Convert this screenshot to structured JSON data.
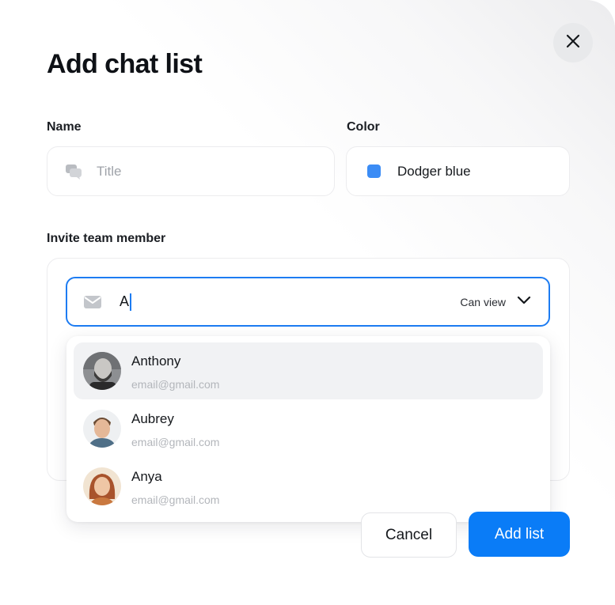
{
  "dialog": {
    "title": "Add chat list",
    "close_icon": "close-icon"
  },
  "name_field": {
    "label": "Name",
    "placeholder": "Title",
    "icon": "chat-bubbles-icon"
  },
  "color_field": {
    "label": "Color",
    "value": "Dodger blue",
    "swatch_color": "#3b8cf5"
  },
  "invite": {
    "label": "Invite team member",
    "input_value": "A",
    "input_icon": "mail-icon",
    "permission": "Can view",
    "permission_icon": "chevron-down-icon",
    "suggestions": [
      {
        "name": "Anthony",
        "email": "email@gmail.com",
        "active": true
      },
      {
        "name": "Aubrey",
        "email": "email@gmail.com",
        "active": false
      },
      {
        "name": "Anya",
        "email": "email@gmail.com",
        "active": false
      }
    ]
  },
  "actions": {
    "cancel_label": "Cancel",
    "submit_label": "Add list"
  },
  "colors": {
    "accent": "#0a7cf7",
    "focus_border": "#1d7cf2"
  }
}
